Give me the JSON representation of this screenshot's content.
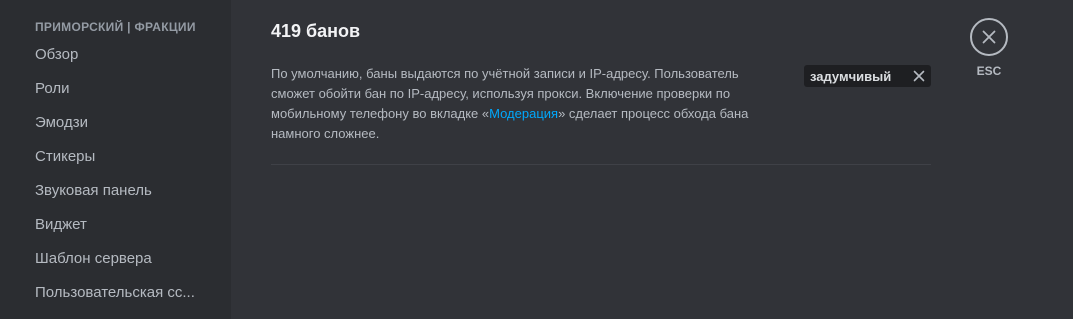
{
  "sidebar": {
    "header": "ПРИМОРСКИЙ | ФРАКЦИИ",
    "items": [
      {
        "label": "Обзор"
      },
      {
        "label": "Роли"
      },
      {
        "label": "Эмодзи"
      },
      {
        "label": "Стикеры"
      },
      {
        "label": "Звуковая панель"
      },
      {
        "label": "Виджет"
      },
      {
        "label": "Шаблон сервера"
      },
      {
        "label": "Пользовательская сс..."
      }
    ]
  },
  "main": {
    "title": "419 банов",
    "description_part1": "По умолчанию, баны выдаются по учётной записи и IP-адресу. Пользователь сможет обойти бан по IP-адресу, используя прокси. Включение проверки по мобильному телефону во вкладке «",
    "description_link": "Модерация",
    "description_part2": "» сделает процесс обхода бана намного сложнее.",
    "search_value": "задумчивый"
  },
  "close": {
    "label": "ESC"
  },
  "colors": {
    "sidebar_bg": "#2b2d31",
    "main_bg": "#313338",
    "link": "#00a8fc",
    "text_muted": "#b5bac1",
    "title": "#f2f3f5"
  }
}
